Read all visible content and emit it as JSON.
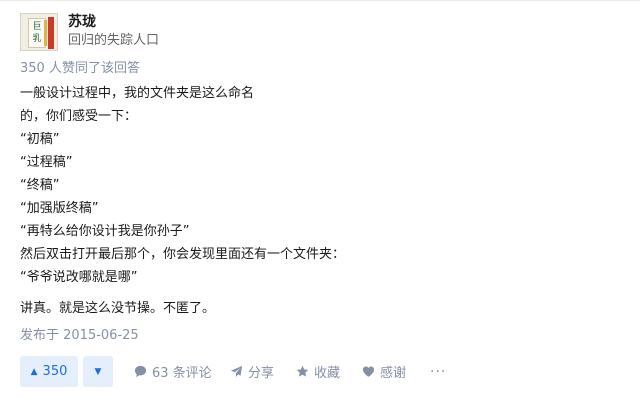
{
  "author": {
    "name": "苏珑",
    "bio": "回归的失踪人口",
    "avatar_glyphs": [
      "巨",
      "乳"
    ]
  },
  "upvote_info": "350 人赞同了该回答",
  "content_lines": [
    "一般设计过程中，我的文件夹是这么命名",
    "的，你们感受一下：",
    "“初稿”",
    "“过程稿”",
    "“终稿”",
    "“加强版终稿”",
    "“再特么给你设计我是你孙子”",
    "然后双击打开最后那个，你会发现里面还有一个文件夹：",
    "“爷爷说改哪就是哪”",
    "",
    "讲真。就是这么没节操。不匿了。"
  ],
  "publish_date": "发布于 2015-06-25",
  "actions": {
    "upvote_icon": "triangle-up-icon",
    "upvote_count": "350",
    "downvote_icon": "triangle-down-icon",
    "comment_icon": "speech-bubble-icon",
    "comments": "63 条评论",
    "share_icon": "paper-plane-icon",
    "share": "分享",
    "collect_icon": "star-icon",
    "collect": "收藏",
    "thanks_icon": "heart-icon",
    "thanks": "感谢",
    "more": "···"
  },
  "colors": {
    "accent": "#1e6fd9",
    "accent_bg": "#e5eefb",
    "meta_text": "#8590a6"
  }
}
